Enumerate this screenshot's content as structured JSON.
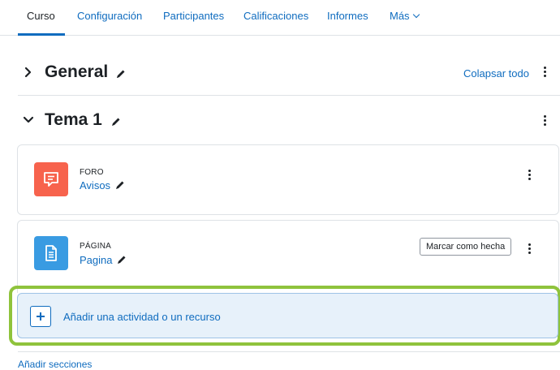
{
  "nav": {
    "tabs": [
      {
        "label": "Curso"
      },
      {
        "label": "Configuración"
      },
      {
        "label": "Participantes"
      },
      {
        "label": "Calificaciones"
      },
      {
        "label": "Informes"
      },
      {
        "label": "Más"
      }
    ]
  },
  "sections": {
    "general": {
      "title": "General",
      "collapse_all": "Colapsar todo"
    },
    "tema1": {
      "title": "Tema 1"
    }
  },
  "activities": [
    {
      "type": "FORO",
      "name": "Avisos",
      "icon": "forum-icon",
      "color": "#f7634d"
    },
    {
      "type": "PÁGINA",
      "name": "Pagina",
      "icon": "page-icon",
      "color": "#399be2",
      "mark_done": "Marcar como hecha"
    }
  ],
  "add_activity": {
    "label": "Añadir una actividad o un recurso",
    "highlight_color": "#8fc33c"
  },
  "add_sections": {
    "label": "Añadir secciones"
  },
  "colors": {
    "accent": "#0f6cbf",
    "text": "#1d2125"
  }
}
